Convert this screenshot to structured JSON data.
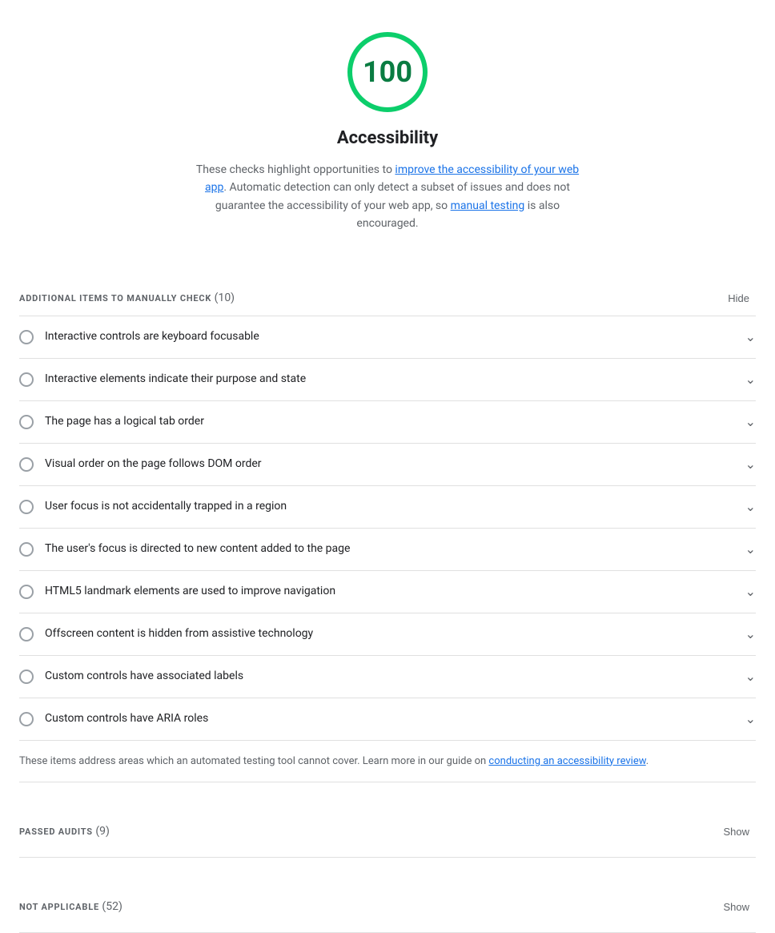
{
  "score": {
    "value": "100",
    "label": "Accessibility",
    "description_part1": "These checks highlight opportunities to ",
    "link1_text": "improve the accessibility of your web app",
    "description_part2": ". Automatic detection can only detect a subset of issues and does not guarantee the accessibility of your web app, so ",
    "link2_text": "manual testing",
    "description_part3": " is also encouraged."
  },
  "manual_section": {
    "title": "ADDITIONAL ITEMS TO MANUALLY CHECK",
    "count": "(10)",
    "toggle_label": "Hide"
  },
  "audit_items": [
    {
      "id": "item-1",
      "label": "Interactive controls are keyboard focusable"
    },
    {
      "id": "item-2",
      "label": "Interactive elements indicate their purpose and state"
    },
    {
      "id": "item-3",
      "label": "The page has a logical tab order"
    },
    {
      "id": "item-4",
      "label": "Visual order on the page follows DOM order"
    },
    {
      "id": "item-5",
      "label": "User focus is not accidentally trapped in a region"
    },
    {
      "id": "item-6",
      "label": "The user's focus is directed to new content added to the page"
    },
    {
      "id": "item-7",
      "label": "HTML5 landmark elements are used to improve navigation"
    },
    {
      "id": "item-8",
      "label": "Offscreen content is hidden from assistive technology"
    },
    {
      "id": "item-9",
      "label": "Custom controls have associated labels"
    },
    {
      "id": "item-10",
      "label": "Custom controls have ARIA roles"
    }
  ],
  "manual_footer": {
    "text_before": "These items address areas which an automated testing tool cannot cover. Learn more in our guide on ",
    "link_text": "conducting an accessibility review",
    "text_after": "."
  },
  "passed_section": {
    "title": "PASSED AUDITS",
    "count": "(9)",
    "toggle_label": "Show"
  },
  "not_applicable_section": {
    "title": "NOT APPLICABLE",
    "count": "(52)",
    "toggle_label": "Show"
  }
}
